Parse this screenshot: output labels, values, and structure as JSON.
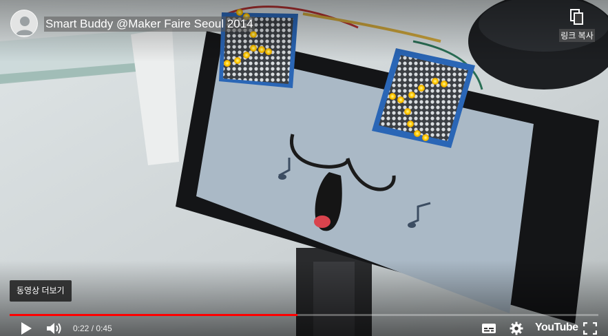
{
  "header": {
    "title": "Smart Buddy @Maker Faire Seoul 2014",
    "copy_link_label": "링크 복사"
  },
  "overlay": {
    "more_videos_label": "동영상 더보기"
  },
  "progress": {
    "played_fraction": 0.489,
    "loaded_fraction": 0.489
  },
  "controls": {
    "time_current": "0:22",
    "time_separator": " / ",
    "time_total": "0:45",
    "brand": "YouTube"
  },
  "icons": {
    "play": "play-icon",
    "volume": "volume-icon",
    "subtitles": "subtitles-icon",
    "settings": "gear-icon",
    "fullscreen": "fullscreen-icon",
    "copy": "copy-icon"
  },
  "colors": {
    "progress_red": "#ff0000",
    "led_yellow": "#ffcc00",
    "screen_blue": "#aab9c6"
  }
}
